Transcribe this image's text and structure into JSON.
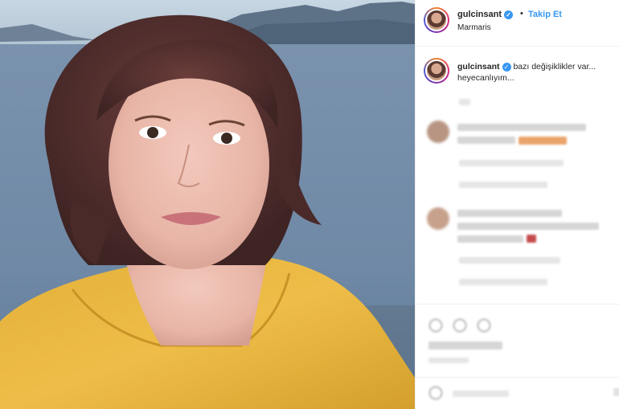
{
  "post": {
    "username": "gulcinsant",
    "follow_label": "Takip Et",
    "separator": "•",
    "location": "Marmaris",
    "caption_username": "gulcinsant",
    "caption_text": "bazı değişiklikler var... heyecanlıyım..."
  },
  "colors": {
    "link_blue": "#3897f0",
    "verified_blue": "#3897f0",
    "border": "#efefef"
  },
  "icons": [
    "verified-badge-icon",
    "heart-icon",
    "comment-icon",
    "share-icon",
    "emoji-icon"
  ]
}
